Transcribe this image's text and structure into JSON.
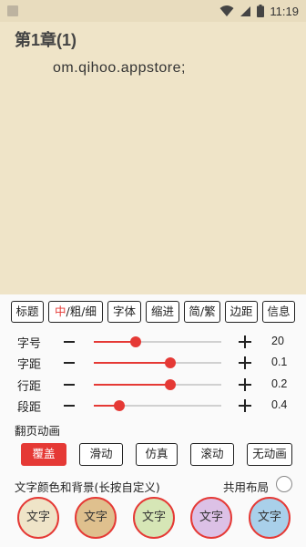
{
  "status_bar": {
    "time": "11:19",
    "icons": [
      "notification-icon",
      "wifi-icon",
      "cell-signal-icon",
      "battery-icon"
    ]
  },
  "reader": {
    "chapter_title": "第1章(1)",
    "content": "om.qihoo.appstore;"
  },
  "menu_tabs": [
    {
      "label": "标题"
    },
    {
      "label_highlight": "中",
      "label_rest": "/粗/细"
    },
    {
      "label": "字体"
    },
    {
      "label": "缩进"
    },
    {
      "label": "简/繁"
    },
    {
      "label": "边距"
    },
    {
      "label": "信息"
    }
  ],
  "sliders": [
    {
      "label": "字号",
      "value": "20",
      "level": 0.33
    },
    {
      "label": "字距",
      "value": "0.1",
      "level": 0.6
    },
    {
      "label": "行距",
      "value": "0.2",
      "level": 0.6
    },
    {
      "label": "段距",
      "value": "0.4",
      "level": 0.2
    }
  ],
  "page_turn": {
    "label": "翻页动画",
    "options": [
      "覆盖",
      "滑动",
      "仿真",
      "滚动",
      "无动画"
    ],
    "selected": "覆盖"
  },
  "color_section": {
    "label": "文字颜色和背景(长按自定义)",
    "shared_layout_label": "共用布局",
    "swatches": [
      {
        "text": "文字",
        "bg": "#efe4c8"
      },
      {
        "text": "文字",
        "bg": "#dfc08e"
      },
      {
        "text": "文字",
        "bg": "#d6e6b6"
      },
      {
        "text": "文字",
        "bg": "#dcc1e6"
      },
      {
        "text": "文字",
        "bg": "#a9d0ea"
      }
    ]
  },
  "colors": {
    "accent": "#e53935",
    "paper": "#efe4c8"
  }
}
